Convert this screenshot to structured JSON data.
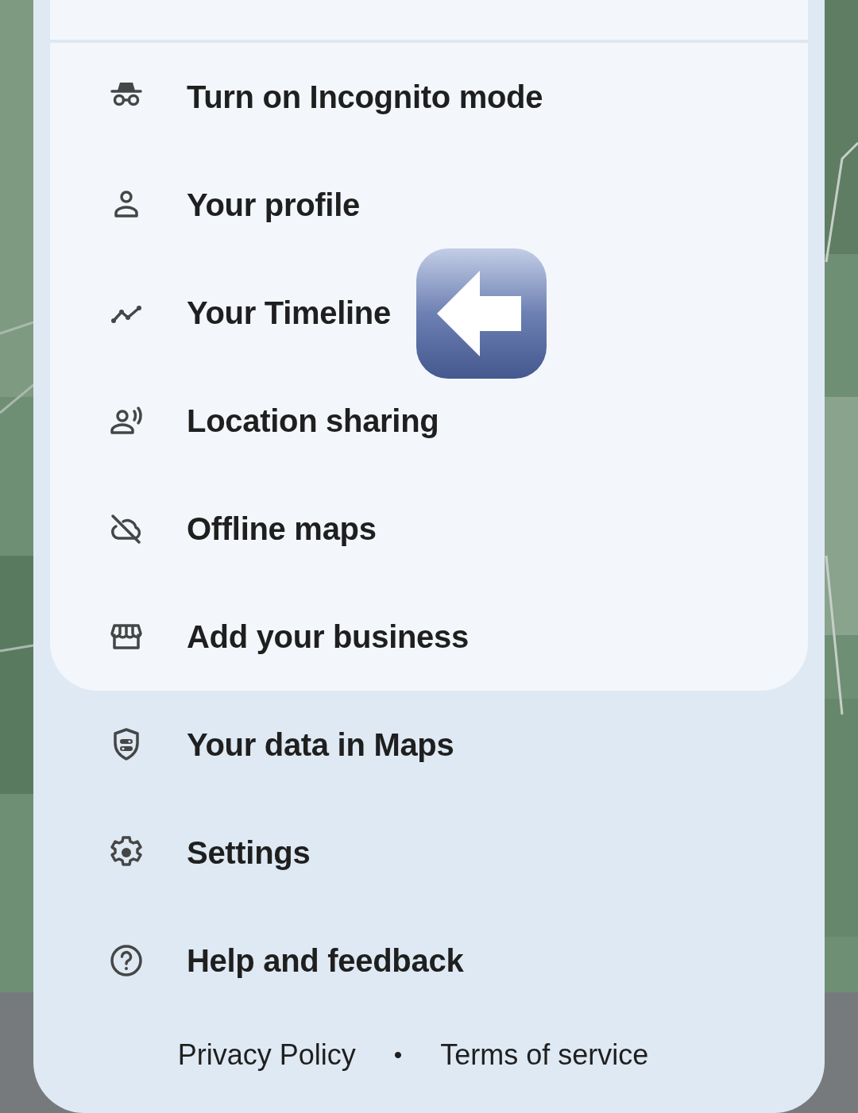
{
  "card_items": [
    {
      "label": "Turn on Incognito mode"
    },
    {
      "label": "Your profile"
    },
    {
      "label": "Your Timeline"
    },
    {
      "label": "Location sharing"
    },
    {
      "label": "Offline maps"
    },
    {
      "label": "Add your business"
    }
  ],
  "more_items": [
    {
      "label": "Your data in Maps"
    },
    {
      "label": "Settings"
    },
    {
      "label": "Help and feedback"
    }
  ],
  "footer": {
    "links": [
      "Privacy Policy",
      "Terms of service"
    ],
    "separator": "•"
  }
}
